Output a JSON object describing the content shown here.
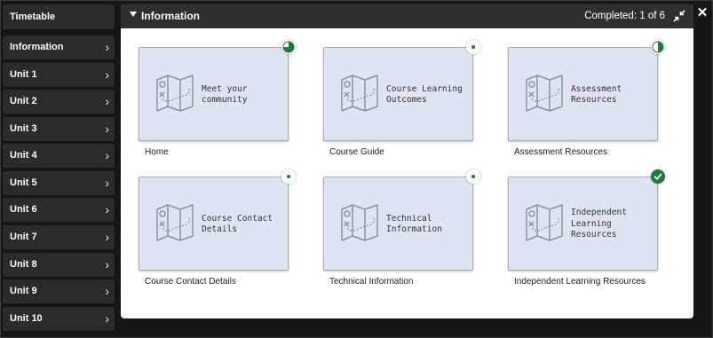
{
  "sidebar": {
    "items": [
      {
        "label": "Timetable",
        "has_chevron": false
      },
      {
        "label": "Information",
        "has_chevron": true
      },
      {
        "label": "Unit 1",
        "has_chevron": true
      },
      {
        "label": "Unit 2",
        "has_chevron": true
      },
      {
        "label": "Unit 3",
        "has_chevron": true
      },
      {
        "label": "Unit 4",
        "has_chevron": true
      },
      {
        "label": "Unit 5",
        "has_chevron": true
      },
      {
        "label": "Unit 6",
        "has_chevron": true
      },
      {
        "label": "Unit 7",
        "has_chevron": true
      },
      {
        "label": "Unit 8",
        "has_chevron": true
      },
      {
        "label": "Unit 9",
        "has_chevron": true
      },
      {
        "label": "Unit 10",
        "has_chevron": true
      }
    ],
    "chevron_glyph": "›"
  },
  "panel": {
    "title": "Information",
    "completed": "Completed: 1 of 6",
    "collapse_icon": "collapse-arrows-icon",
    "close_glyph": "✕"
  },
  "cards": [
    {
      "card_text": "Meet your\ncommunity",
      "caption": "Home",
      "progress_status": "in-progress",
      "progress_fraction": 0.75
    },
    {
      "card_text": "Course Learning\nOutcomes",
      "caption": "Course Guide",
      "progress_status": "not-started",
      "progress_fraction": 0
    },
    {
      "card_text": "Assessment\nResources",
      "caption": "Assessment Resources",
      "progress_status": "in-progress",
      "progress_fraction": 0.5
    },
    {
      "card_text": "Course Contact\nDetails",
      "caption": "Course Contact Details",
      "progress_status": "not-started",
      "progress_fraction": 0
    },
    {
      "card_text": "Technical\nInformation",
      "caption": "Technical Information",
      "progress_status": "not-started",
      "progress_fraction": 0
    },
    {
      "card_text": "Independent\nLearning\nResources",
      "caption": "Independent Learning Resources",
      "progress_status": "completed",
      "progress_fraction": 1
    }
  ],
  "colors": {
    "accent_green": "#1f7a3c",
    "card_bg": "#dfe4f2",
    "header_bg": "#2f2f2f",
    "sidebar_item_bg": "#2b2b2b"
  },
  "icons": {
    "card_icon": "treasure-map-icon",
    "progress_icon": "progress-pie-icon",
    "complete_icon": "check-circle-icon"
  }
}
